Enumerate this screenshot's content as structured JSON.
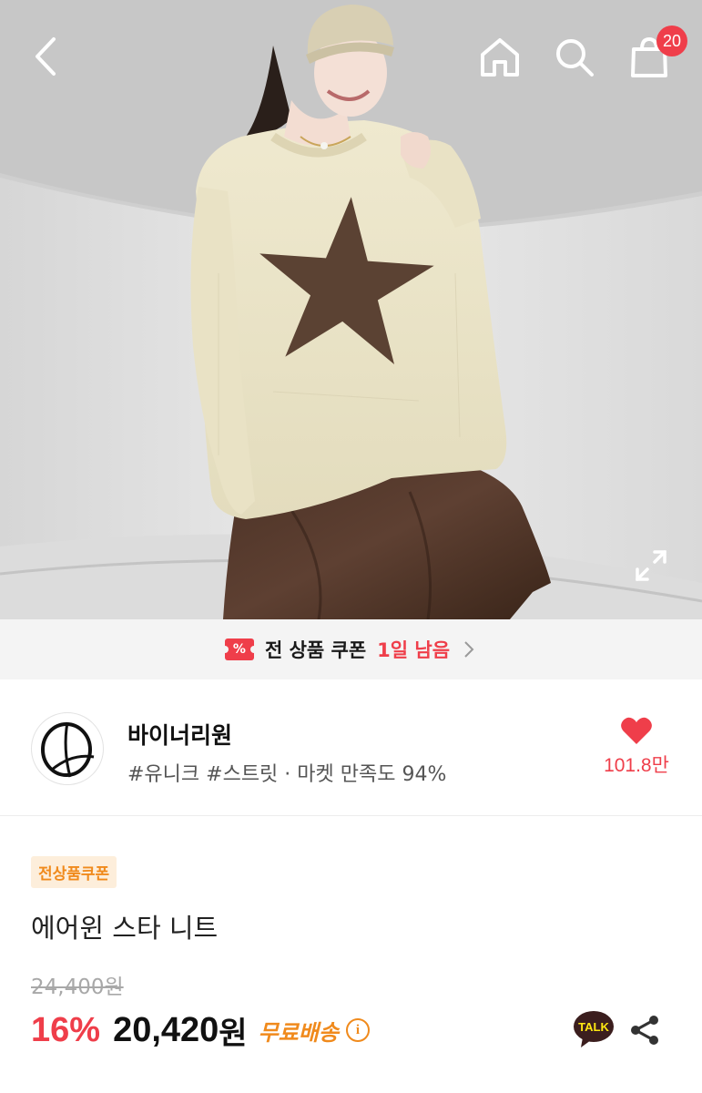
{
  "header": {
    "cart_count": "20",
    "icons": {
      "back": "chevron-left-icon",
      "home": "home-icon",
      "search": "search-icon",
      "cart": "shopping-bag-icon",
      "expand": "expand-icon"
    }
  },
  "coupon_banner": {
    "icon_glyph": "%",
    "label": "전 상품 쿠폰",
    "remaining": "1일 남음"
  },
  "shop": {
    "name": "바이너리원",
    "tags": "#유니크 #스트릿 · 마켓 만족도 94%",
    "likes": "101.8만"
  },
  "product": {
    "badge": "전상품쿠폰",
    "title": "에어윈 스타 니트",
    "original_price": "24,400원",
    "discount": "16%",
    "price": "20,420",
    "price_unit": "원",
    "shipping": "무료배송",
    "info_glyph": "i"
  },
  "actions": {
    "kakao_label": "TALK"
  },
  "colors": {
    "accent_red": "#ef3e4a",
    "accent_orange": "#f08a1c",
    "coupon_chip_bg": "#fdeedb",
    "kakao_dark": "#3b1e1e"
  }
}
